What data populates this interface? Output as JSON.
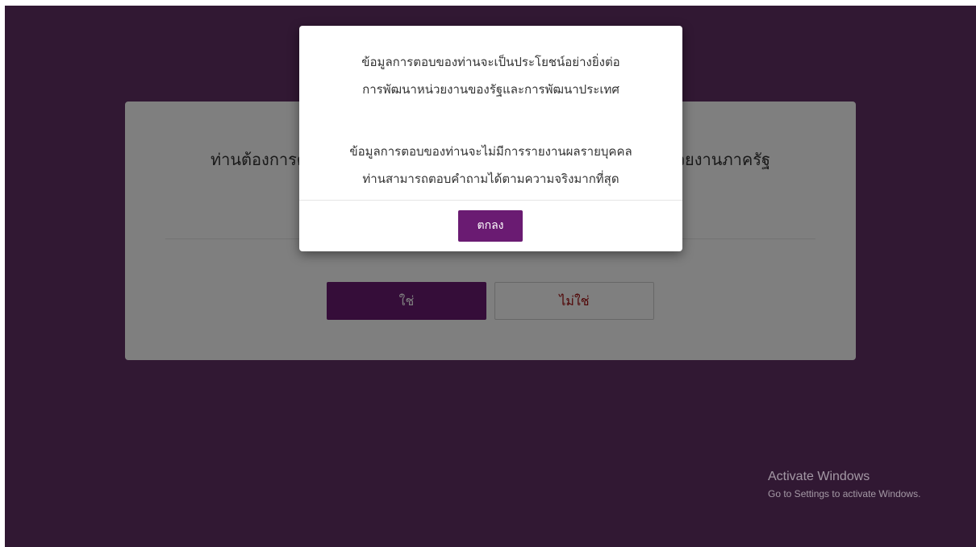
{
  "page": {
    "background_color": "#633166",
    "overlay_color": "rgba(0,0,0,0.5)",
    "accent_color": "#6a1b72",
    "no_text_color": "#a00b0b"
  },
  "card": {
    "question": "ท่านต้องการตอบแบบสอบถามความพึงพอใจต่อการให้บริการของหน่วยงานภาครัฐ",
    "yes_label": "ใช่",
    "no_label": "ไม่ใช่"
  },
  "modal": {
    "line1": "ข้อมูลการตอบของท่านจะเป็นประโยชน์อย่างยิ่งต่อ",
    "line2": "การพัฒนาหน่วยงานของรัฐและการพัฒนาประเทศ",
    "line3": "ข้อมูลการตอบของท่านจะไม่มีการรายงานผลรายบุคคล",
    "line4": "ท่านสามารถตอบคำถามได้ตามความจริงมากที่สุด",
    "ok_label": "ตกลง"
  },
  "watermark": {
    "title": "Activate Windows",
    "subtitle": "Go to Settings to activate Windows."
  }
}
